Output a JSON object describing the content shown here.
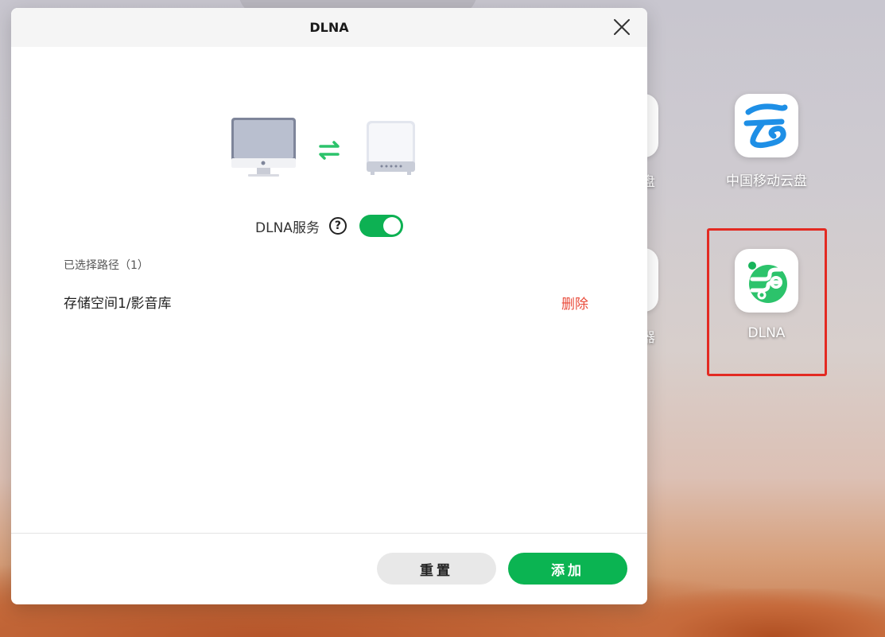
{
  "dialog": {
    "title": "DLNA",
    "service_label": "DLNA服务",
    "service_enabled": true,
    "help_glyph": "?",
    "selected_paths_header": "已选择路径（1）",
    "paths": [
      {
        "path": "存储空间1/影音库",
        "delete_label": "删除"
      }
    ],
    "reset_label": "重置",
    "add_label": "添加"
  },
  "desktop": {
    "icons": [
      {
        "label": "中国移动云盘",
        "icon": "china-mobile-cloud-icon"
      },
      {
        "label": "DLNA",
        "icon": "dlna-app-icon"
      }
    ],
    "partial_labels": [
      "盘",
      "器"
    ]
  },
  "colors": {
    "accent_green": "#0bb452",
    "delete_red": "#e94b3a",
    "highlight_red": "#e32a22",
    "cloud_blue": "#1e8fe6"
  }
}
